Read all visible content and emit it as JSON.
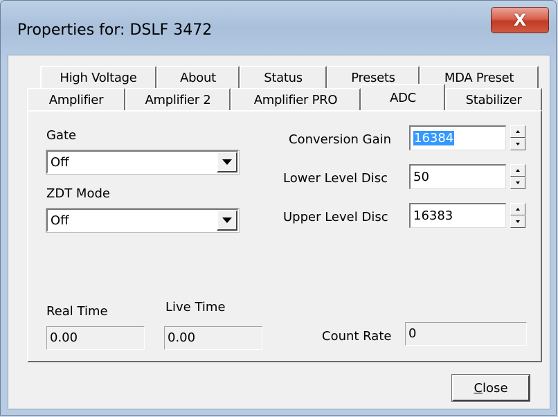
{
  "window": {
    "title": "Properties for: DSLF 3472",
    "close_glyph": "X"
  },
  "tabs_row1": [
    {
      "label": "High Voltage"
    },
    {
      "label": "About"
    },
    {
      "label": "Status"
    },
    {
      "label": "Presets"
    },
    {
      "label": "MDA Preset"
    }
  ],
  "tabs_row2": [
    {
      "label": "Amplifier"
    },
    {
      "label": "Amplifier 2"
    },
    {
      "label": "Amplifier PRO"
    },
    {
      "label": "ADC",
      "active": true
    },
    {
      "label": "Stabilizer"
    }
  ],
  "adc": {
    "gate_label": "Gate",
    "gate_value": "Off",
    "zdt_label": "ZDT Mode",
    "zdt_value": "Off",
    "conversion_gain_label": "Conversion Gain",
    "conversion_gain_value": "16384",
    "lower_level_label": "Lower Level Disc",
    "lower_level_value": "50",
    "upper_level_label": "Upper Level Disc",
    "upper_level_value": "16383",
    "real_time_label": "Real Time",
    "real_time_value": "0.00",
    "live_time_label": "Live Time",
    "live_time_value": "0.00",
    "count_rate_label": "Count Rate",
    "count_rate_value": "0"
  },
  "footer": {
    "close_mnemonic": "C",
    "close_rest": "lose"
  },
  "colors": {
    "selection": "#3399ff",
    "title_close": "#c23b24"
  }
}
